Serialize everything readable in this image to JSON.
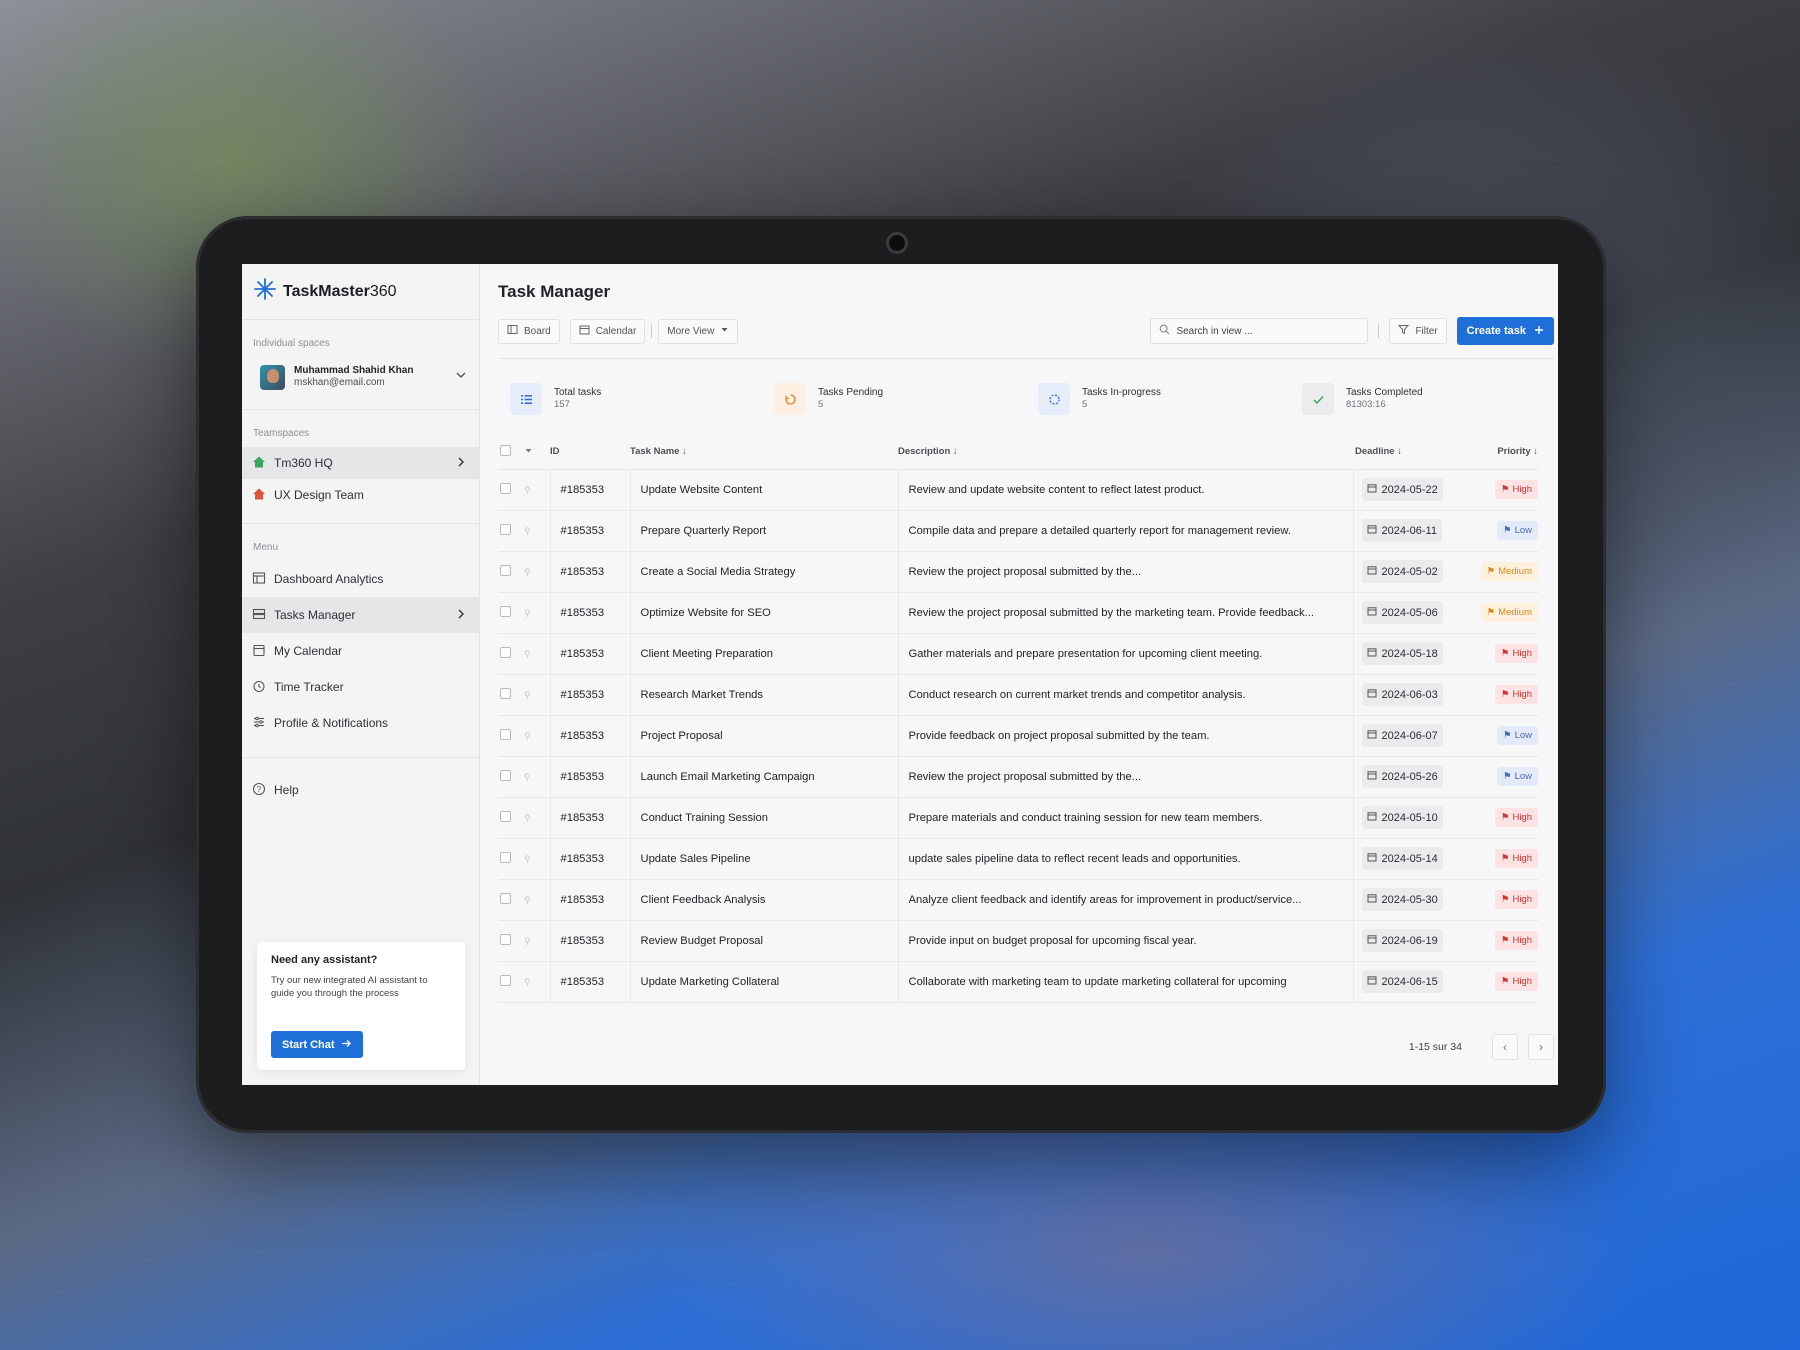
{
  "brand": {
    "name_bold": "TaskMaster",
    "name_light": "360"
  },
  "sidebar": {
    "individual_label": "Individual spaces",
    "user": {
      "name": "Muhammad Shahid Khan",
      "email": "mskhan@email.com"
    },
    "teamspaces_label": "Teamspaces",
    "teamspaces": [
      {
        "label": "Tm360 HQ",
        "icon": "home-icon",
        "color": "#3aa55b",
        "active": true
      },
      {
        "label": "UX Design Team",
        "icon": "home-icon",
        "color": "#e0533a",
        "active": false
      }
    ],
    "menu_label": "Menu",
    "menu": [
      {
        "label": "Dashboard Analytics",
        "icon": "dashboard-icon"
      },
      {
        "label": "Tasks Manager",
        "icon": "tasks-icon",
        "active": true
      },
      {
        "label": "My Calendar",
        "icon": "calendar-icon"
      },
      {
        "label": "Time Tracker",
        "icon": "timer-icon"
      },
      {
        "label": "Profile & Notifications",
        "icon": "settings-sliders-icon"
      }
    ],
    "help_label": "Help",
    "assistant": {
      "title": "Need any assistant?",
      "text": "Try our new integrated AI assistant to guide you through the process",
      "button": "Start Chat"
    }
  },
  "main": {
    "title": "Task Manager",
    "toolbar": {
      "board": "Board",
      "calendar": "Calendar",
      "more_view": "More View",
      "search_placeholder": "Search in view ...",
      "filter": "Filter",
      "create": "Create task"
    },
    "stats": [
      {
        "label": "Total tasks",
        "value": "157",
        "icon": "list-icon",
        "color": "#3a6fd8",
        "bg": "#e6edfb"
      },
      {
        "label": "Tasks Pending",
        "value": "5",
        "icon": "pending-icon",
        "color": "#e2842c",
        "bg": "#fdf0e2"
      },
      {
        "label": "Tasks In-progress",
        "value": "5",
        "icon": "progress-icon",
        "color": "#3a6fd8",
        "bg": "#e6edfb"
      },
      {
        "label": "Tasks Completed",
        "value": "81303:16",
        "icon": "check-icon",
        "color": "#3aa55b",
        "bg": "#ececee"
      }
    ],
    "columns": {
      "id": "ID",
      "task_name": "Task Name",
      "description": "Description",
      "deadline": "Deadline",
      "priority": "Priority"
    },
    "rows": [
      {
        "id": "#185353",
        "name": "Update Website Content",
        "desc": "Review and update website content to reflect latest product.",
        "deadline": "2024-05-22",
        "priority": "High"
      },
      {
        "id": "#185353",
        "name": "Prepare Quarterly Report",
        "desc": "Compile data and prepare a detailed quarterly report for management review.",
        "deadline": "2024-06-11",
        "priority": "Low"
      },
      {
        "id": "#185353",
        "name": "Create a Social Media Strategy",
        "desc": "Review the project proposal submitted by the...",
        "deadline": "2024-05-02",
        "priority": "Medium"
      },
      {
        "id": "#185353",
        "name": "Optimize Website for SEO",
        "desc": "Review the project proposal submitted by the marketing team. Provide feedback...",
        "deadline": "2024-05-06",
        "priority": "Medium"
      },
      {
        "id": "#185353",
        "name": "Client Meeting Preparation",
        "desc": "Gather materials and prepare presentation for upcoming client meeting.",
        "deadline": "2024-05-18",
        "priority": "High"
      },
      {
        "id": "#185353",
        "name": "Research Market Trends",
        "desc": "Conduct research on current market trends and competitor analysis.",
        "deadline": "2024-06-03",
        "priority": "High"
      },
      {
        "id": "#185353",
        "name": "Project Proposal",
        "desc": "Provide feedback on project proposal submitted by the team.",
        "deadline": "2024-06-07",
        "priority": "Low"
      },
      {
        "id": "#185353",
        "name": "Launch Email Marketing Campaign",
        "desc": "Review the project proposal submitted by the...",
        "deadline": "2024-05-26",
        "priority": "Low"
      },
      {
        "id": "#185353",
        "name": "Conduct Training Session",
        "desc": "Prepare materials and conduct training session for new team members.",
        "deadline": "2024-05-10",
        "priority": "High"
      },
      {
        "id": "#185353",
        "name": "Update Sales Pipeline",
        "desc": "update sales pipeline data to reflect recent leads and opportunities.",
        "deadline": "2024-05-14",
        "priority": "High"
      },
      {
        "id": "#185353",
        "name": "Client Feedback Analysis",
        "desc": "Analyze client feedback and identify areas for improvement in product/service...",
        "deadline": "2024-05-30",
        "priority": "High"
      },
      {
        "id": "#185353",
        "name": "Review Budget Proposal",
        "desc": "Provide input on budget proposal for upcoming fiscal year.",
        "deadline": "2024-06-19",
        "priority": "High"
      },
      {
        "id": "#185353",
        "name": "Update Marketing Collateral",
        "desc": "Collaborate with marketing team to update marketing collateral for upcoming",
        "deadline": "2024-06-15",
        "priority": "High"
      }
    ],
    "pagination": {
      "label": "1-15 sur 34"
    }
  },
  "colors": {
    "accent": "#1f6fd8",
    "high": "#d4312f",
    "low": "#4a6cb4",
    "medium": "#d88a1b"
  }
}
